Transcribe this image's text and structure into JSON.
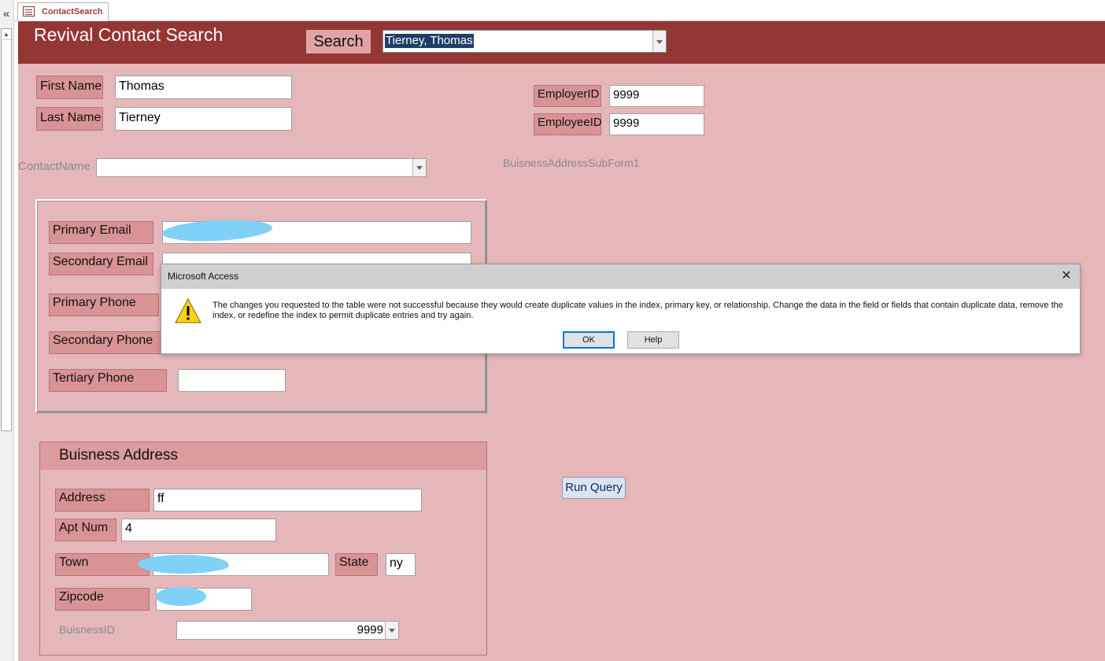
{
  "nav": {
    "collapse_glyph": "«"
  },
  "tab": {
    "label": "ContactSearch",
    "icon": "form-icon"
  },
  "header": {
    "title": "Revival Contact Search",
    "search_button": "Search",
    "search_combo_value": "Tierney, Thomas"
  },
  "person": {
    "first_name_label": "First Name",
    "first_name_value": "Thomas",
    "last_name_label": "Last Name",
    "last_name_value": "Tierney",
    "employer_id_label": "EmployerID",
    "employer_id_value": "9999",
    "employee_id_label": "EmployeeID",
    "employee_id_value": "9999",
    "contact_name_label": "ContactName",
    "contact_name_value": "",
    "subform_label": "BuisnessAddressSubForm1"
  },
  "contact": {
    "primary_email_label": "Primary Email",
    "secondary_email_label": "Secondary Email",
    "primary_phone_label": "Primary Phone",
    "secondary_phone_label": "Secondary Phone",
    "tertiary_phone_label": "Tertiary Phone",
    "tertiary_phone_value": ""
  },
  "address": {
    "title": "Buisness Address",
    "address_label": "Address",
    "address_value": "ff",
    "apt_label": "Apt Num",
    "apt_value": "4",
    "town_label": "Town",
    "state_label": "State",
    "state_value": "ny",
    "zip_label": "Zipcode",
    "business_id_label": "BuisnessID",
    "business_id_value": "9999"
  },
  "run_query": "Run Query",
  "dialog": {
    "title": "Microsoft Access",
    "message": "The changes you requested to the table were not successful because they would create duplicate values in the index, primary key, or relationship. Change the data in the field or fields that contain duplicate data, remove the index, or redefine the index to permit duplicate entries and try again.",
    "ok": "OK",
    "help": "Help",
    "close_glyph": "✕",
    "icon": "warning-icon"
  }
}
